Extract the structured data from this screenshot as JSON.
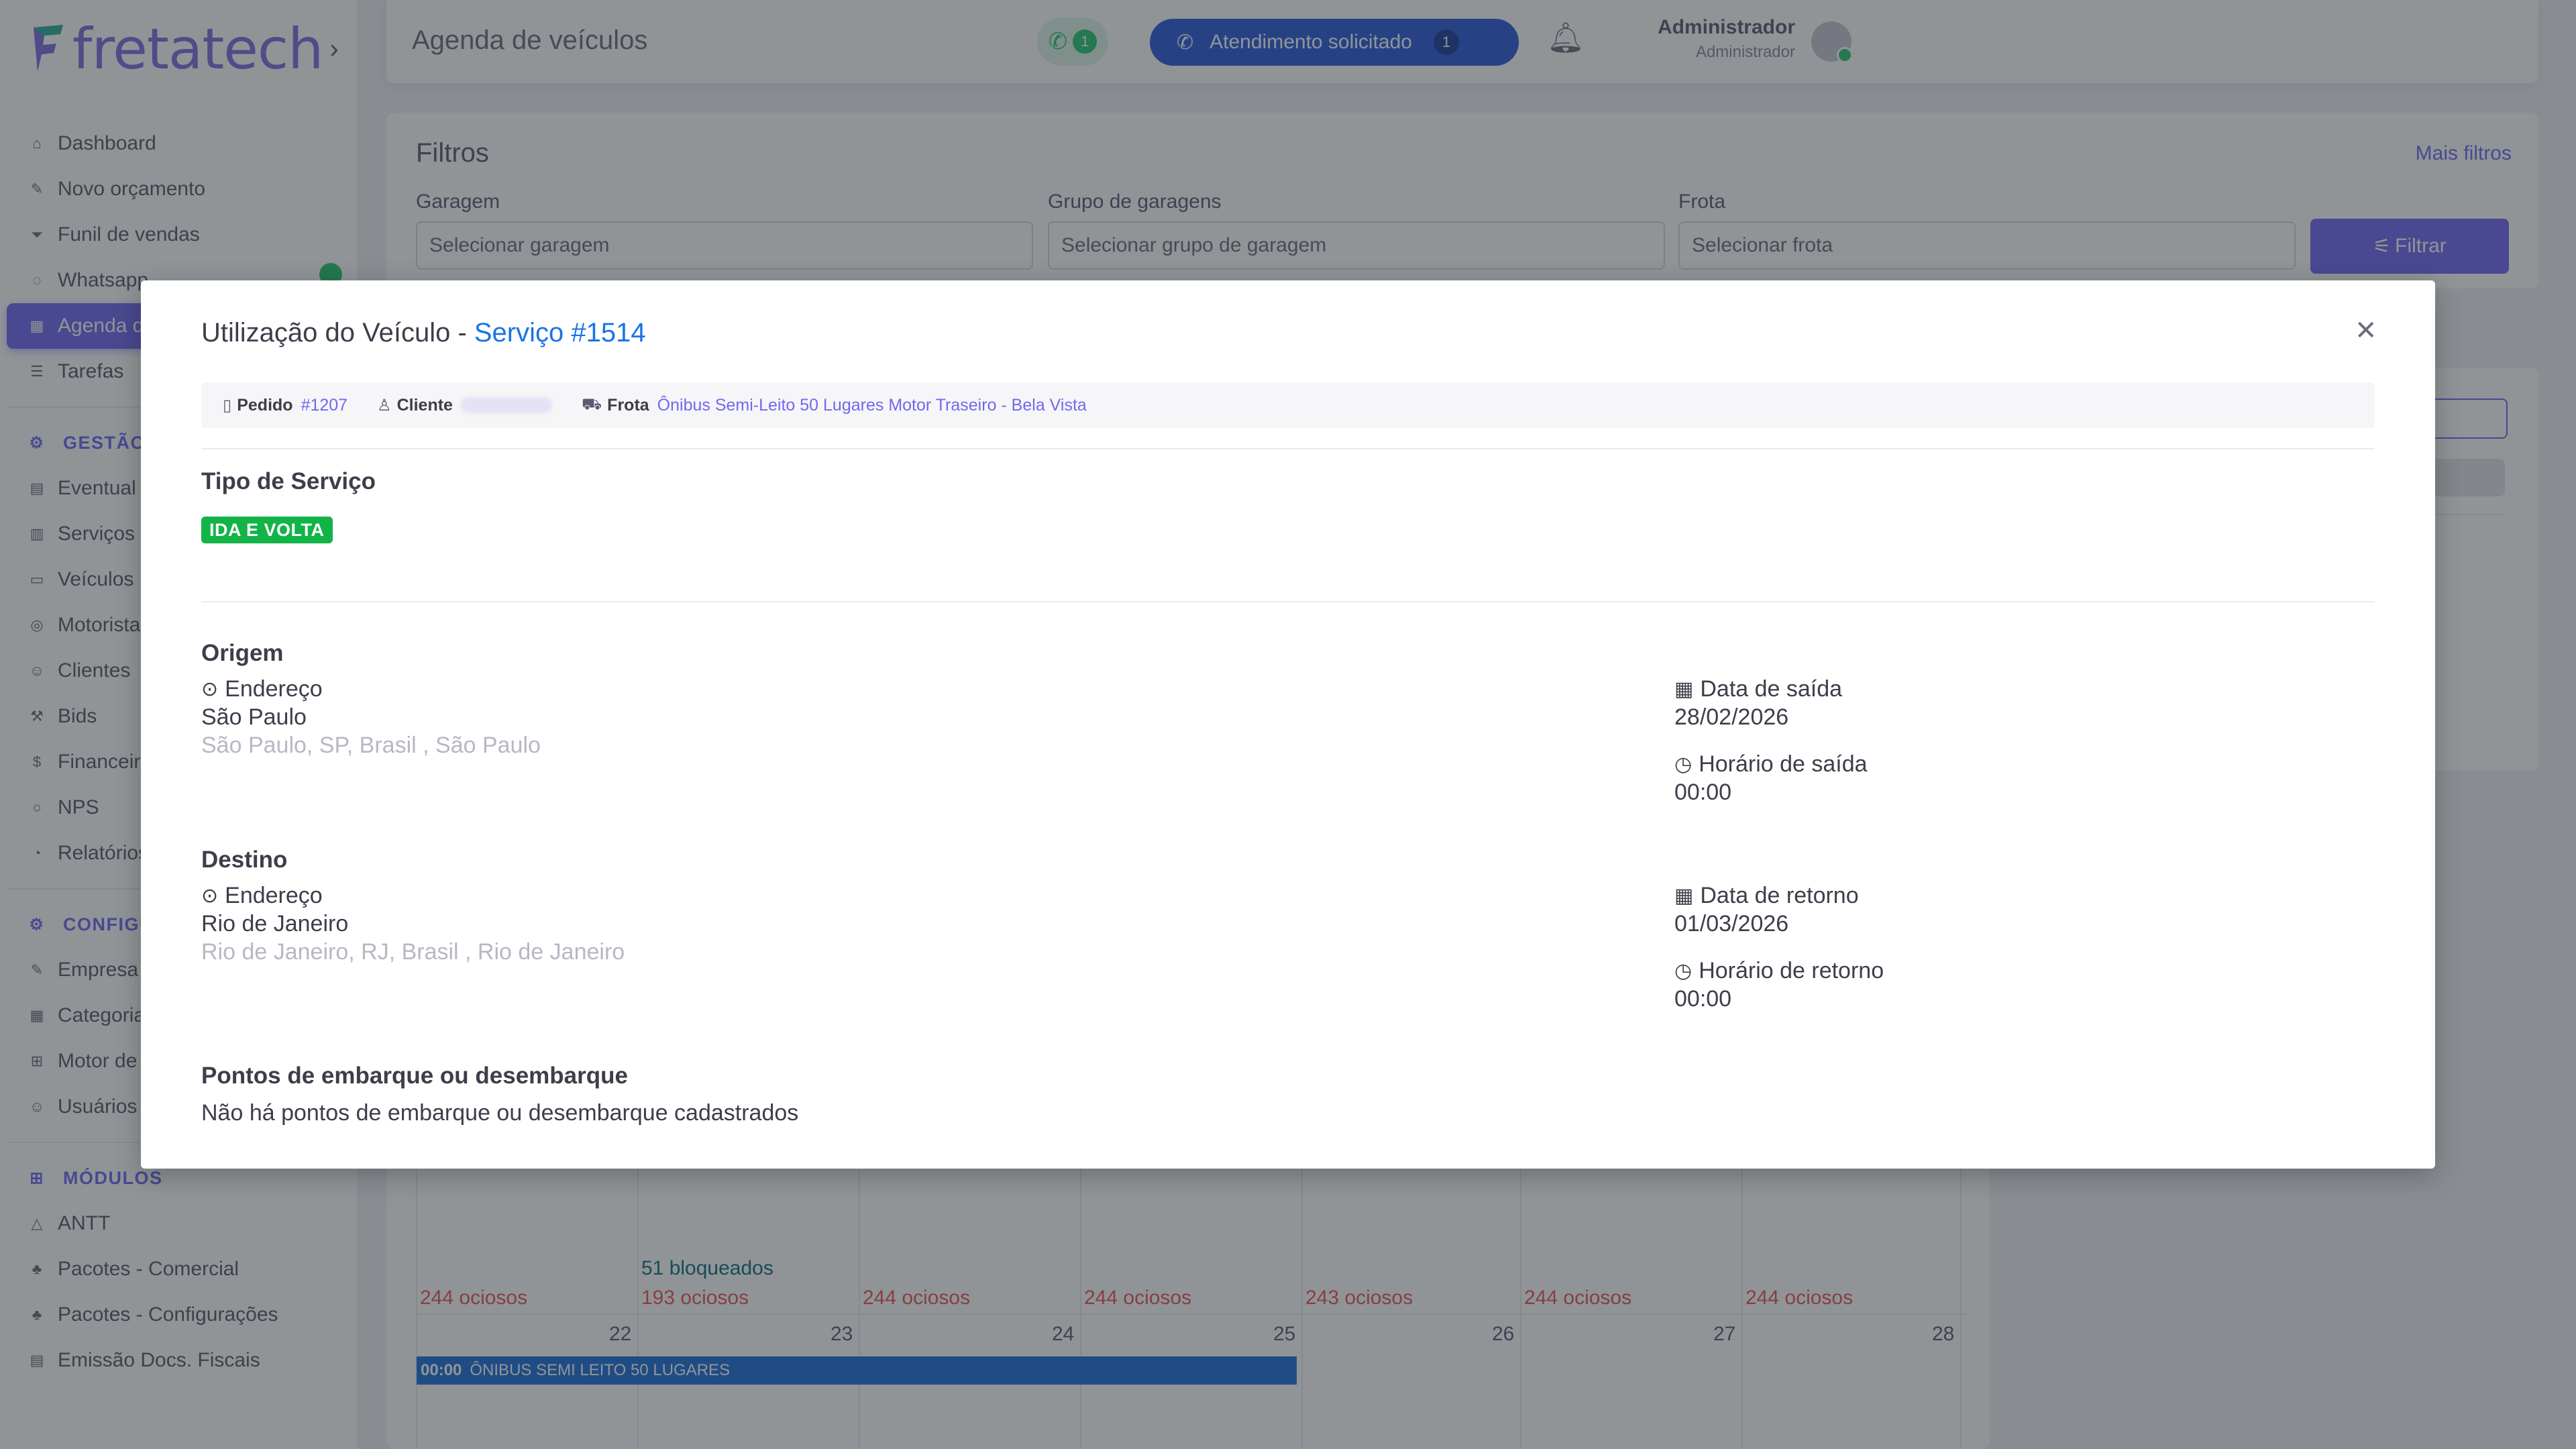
{
  "app": {
    "logo_text": "fretatech"
  },
  "sidebar": {
    "items": [
      {
        "label": "Dashboard",
        "icon": "home-icon"
      },
      {
        "label": "Novo orçamento",
        "icon": "edit-icon"
      },
      {
        "label": "Funil de vendas",
        "icon": "funnel-icon"
      },
      {
        "label": "Whatsapp",
        "icon": "whatsapp-icon"
      },
      {
        "label": "Agenda de veículos",
        "icon": "calendar-icon"
      },
      {
        "label": "Tarefas",
        "icon": "list-icon"
      }
    ],
    "section_gestao": "GESTÃO",
    "gestao_items": [
      {
        "label": "Eventual",
        "icon": "file-icon"
      },
      {
        "label": "Serviços",
        "icon": "clipboard-icon"
      },
      {
        "label": "Veículos",
        "icon": "bus-icon"
      },
      {
        "label": "Motoristas",
        "icon": "steering-icon"
      },
      {
        "label": "Clientes",
        "icon": "users-icon"
      },
      {
        "label": "Bids",
        "icon": "gavel-icon"
      },
      {
        "label": "Financeiro",
        "icon": "dollar-icon"
      },
      {
        "label": "NPS",
        "icon": "chat-icon"
      },
      {
        "label": "Relatórios",
        "icon": "chart-icon"
      }
    ],
    "section_config": "CONFIGURAÇÕES",
    "config_items": [
      {
        "label": "Empresa",
        "icon": "building-icon"
      },
      {
        "label": "Categorias",
        "icon": "grid-icon"
      },
      {
        "label": "Motor de",
        "icon": "table-icon"
      },
      {
        "label": "Usuários",
        "icon": "user-icon"
      }
    ],
    "section_modulos": "MÓDULOS",
    "modulos_items": [
      {
        "label": "ANTT",
        "icon": "triangle-icon"
      },
      {
        "label": "Pacotes - Comercial",
        "icon": "package-icon"
      },
      {
        "label": "Pacotes - Configurações",
        "icon": "package-settings-icon"
      },
      {
        "label": "Emissão Docs. Fiscais",
        "icon": "receipt-icon"
      }
    ]
  },
  "topbar": {
    "title": "Agenda de veículos",
    "whatsapp_count": "1",
    "attendance_label": "Atendimento solicitado",
    "attendance_count": "1",
    "user_name": "Administrador",
    "user_role": "Administrador"
  },
  "filters": {
    "title": "Filtros",
    "more_filters": "Mais filtros",
    "garage_label": "Garagem",
    "garage_placeholder": "Selecionar garagem",
    "garage_group_label": "Grupo de garagens",
    "garage_group_placeholder": "Selecionar grupo de garagem",
    "fleet_label": "Frota",
    "fleet_placeholder": "Selecionar frota",
    "filter_button": "Filtrar"
  },
  "calendar": {
    "row1_idle": [
      "244 ociosos",
      "193 ociosos",
      "244 ociosos",
      "244 ociosos",
      "243 ociosos",
      "244 ociosos",
      "244 ociosos"
    ],
    "row1_blocked": "51 bloqueados",
    "row2_days": [
      "22",
      "23",
      "24",
      "25",
      "26",
      "27",
      "28"
    ],
    "event_time": "00:00",
    "event_label": "ÔNIBUS SEMI LEITO 50 LUGARES"
  },
  "modal": {
    "title_prefix": "Utilização do Veículo - ",
    "title_link": "Serviço #1514",
    "meta": {
      "order_label": "Pedido",
      "order_value": "#1207",
      "client_label": "Cliente",
      "fleet_label": "Frota",
      "fleet_value": "Ônibus Semi-Leito 50 Lugares Motor Traseiro - Bela Vista"
    },
    "service_type_title": "Tipo de Serviço",
    "service_type_badge": "IDA E VOLTA",
    "origin": {
      "title": "Origem",
      "address_label": "Endereço",
      "city": "São Paulo",
      "full_address": "São Paulo, SP, Brasil , São Paulo",
      "date_label": "Data de saída",
      "date_value": "28/02/2026",
      "time_label": "Horário de saída",
      "time_value": "00:00"
    },
    "destination": {
      "title": "Destino",
      "address_label": "Endereço",
      "city": "Rio de Janeiro",
      "full_address": "Rio de Janeiro, RJ, Brasil , Rio de Janeiro",
      "date_label": "Data de retorno",
      "date_value": "01/03/2026",
      "time_label": "Horário de retorno",
      "time_value": "00:00"
    },
    "stops_title": "Pontos de embarque ou desembarque",
    "stops_empty": "Não há pontos de embarque ou desembarque cadastrados"
  },
  "colors": {
    "primary": "#7367f0",
    "link": "#1a73e8",
    "success": "#12b347",
    "danger": "#ea5455",
    "event": "#1e6fd9"
  }
}
